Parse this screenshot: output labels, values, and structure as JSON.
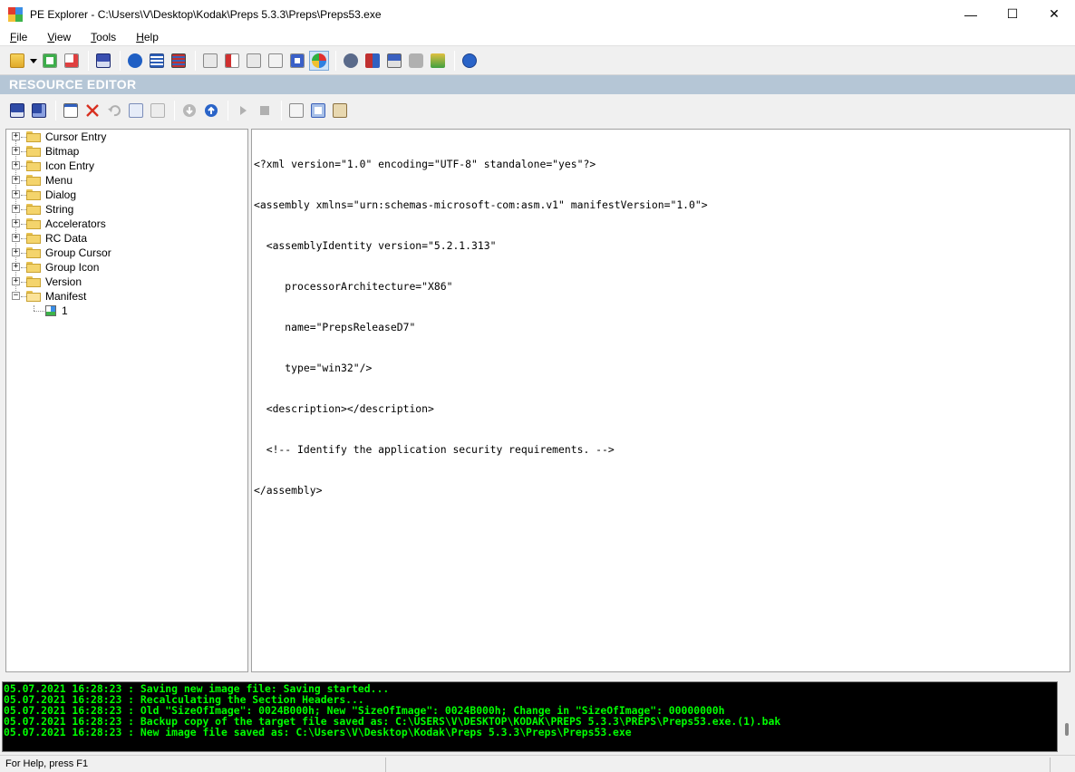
{
  "window": {
    "title": "PE Explorer - C:\\Users\\V\\Desktop\\Kodak\\Preps 5.3.3\\Preps\\Preps53.exe",
    "minimize_glyph": "—",
    "maximize_glyph": "☐",
    "close_glyph": "✕"
  },
  "menu": [
    {
      "accel": "F",
      "rest": "ile"
    },
    {
      "accel": "V",
      "rest": "iew"
    },
    {
      "accel": "T",
      "rest": "ools"
    },
    {
      "accel": "H",
      "rest": "elp"
    }
  ],
  "resource_editor_title": "RESOURCE EDITOR",
  "tree": [
    {
      "label": "Cursor Entry"
    },
    {
      "label": "Bitmap"
    },
    {
      "label": "Icon Entry"
    },
    {
      "label": "Menu"
    },
    {
      "label": "Dialog"
    },
    {
      "label": "String"
    },
    {
      "label": "Accelerators"
    },
    {
      "label": "RC Data"
    },
    {
      "label": "Group Cursor"
    },
    {
      "label": "Group Icon"
    },
    {
      "label": "Version"
    },
    {
      "label": "Manifest"
    }
  ],
  "tree_expanded_child": "1",
  "expander_plus": "+",
  "expander_minus": "−",
  "editor_lines": [
    "<?xml version=\"1.0\" encoding=\"UTF-8\" standalone=\"yes\"?>",
    "<assembly xmlns=\"urn:schemas-microsoft-com:asm.v1\" manifestVersion=\"1.0\">",
    "  <assemblyIdentity version=\"5.2.1.313\"",
    "     processorArchitecture=\"X86\"",
    "     name=\"PrepsReleaseD7\"",
    "     type=\"win32\"/>",
    "  <description></description>",
    "  <!-- Identify the application security requirements. -->",
    "</assembly>"
  ],
  "log_lines": [
    "05.07.2021 16:28:23 : Saving new image file: Saving started...",
    "05.07.2021 16:28:23 : Recalculating the Section Headers...",
    "05.07.2021 16:28:23 : Old \"SizeOfImage\": 0024B000h; New \"SizeOfImage\": 0024B000h; Change in \"SizeOfImage\": 00000000h",
    "05.07.2021 16:28:23 : Backup copy of the target file saved as: C:\\USERS\\V\\DESKTOP\\KODAK\\PREPS 5.3.3\\PREPS\\Preps53.exe.(1).bak",
    "05.07.2021 16:28:23 : New image file saved as: C:\\Users\\V\\Desktop\\Kodak\\Preps 5.3.3\\Preps\\Preps53.exe"
  ],
  "status_text": "For Help, press F1",
  "colors": {
    "header_band": "#b5c6d6",
    "log_background": "#000000",
    "log_text": "#00ff00"
  },
  "toolbar_main_icons": [
    "open-icon",
    "dropdown-arrow-icon",
    "reload-icon",
    "close-file-icon",
    "save-icon",
    "info-icon",
    "headers-icon",
    "sections-icon",
    "import-icon",
    "export-icon",
    "resource-icon",
    "resource2-icon",
    "resource3-icon",
    "resource-editor-icon",
    "disassembler-icon",
    "dependency-icon",
    "syntax-icon",
    "digital-signature-icon",
    "unpack-icon",
    "help-icon"
  ],
  "toolbar_re_icons": [
    "save-resource-icon",
    "save-all-icon",
    "edit-resource-icon",
    "delete-icon",
    "undo-icon",
    "copy-icon",
    "paste-icon",
    "download-icon",
    "upload-icon",
    "play-icon",
    "stop-icon",
    "view-icon",
    "search-icon",
    "properties-icon"
  ]
}
